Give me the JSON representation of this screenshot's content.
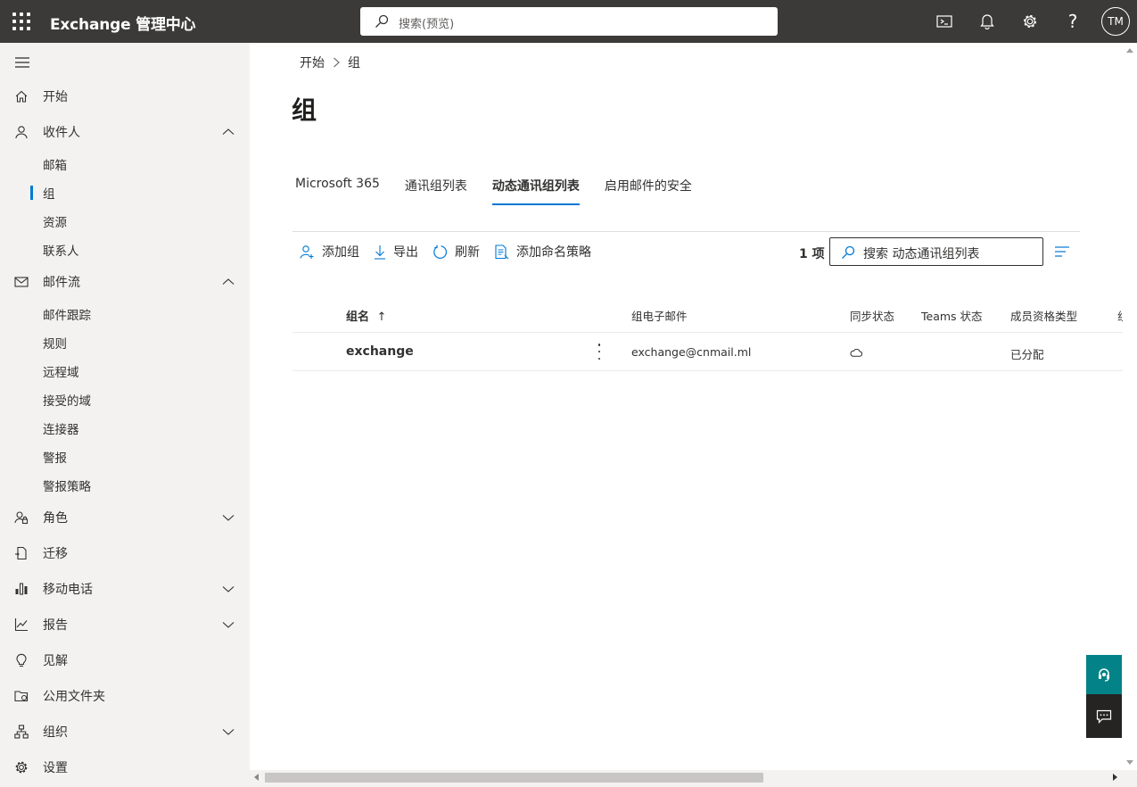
{
  "header": {
    "app_title": "Exchange 管理中心",
    "search_placeholder": "搜索(预览)",
    "avatar_initials": "TM"
  },
  "sidebar": {
    "items": [
      {
        "label": "开始",
        "icon": "home-icon"
      },
      {
        "label": "收件人",
        "icon": "person-icon",
        "expanded": true,
        "children": [
          "邮箱",
          "组",
          "资源",
          "联系人"
        ]
      },
      {
        "label": "邮件流",
        "icon": "mail-icon",
        "expanded": true,
        "children": [
          "邮件跟踪",
          "规则",
          "远程域",
          "接受的域",
          "连接器",
          "警报",
          "警报策略"
        ]
      },
      {
        "label": "角色",
        "icon": "roles-icon",
        "expanded": false
      },
      {
        "label": "迁移",
        "icon": "migration-icon"
      },
      {
        "label": "移动电话",
        "icon": "mobile-icon",
        "expanded": false
      },
      {
        "label": "报告",
        "icon": "reports-icon",
        "expanded": false
      },
      {
        "label": "见解",
        "icon": "lightbulb-icon"
      },
      {
        "label": "公用文件夹",
        "icon": "public-folder-icon"
      },
      {
        "label": "组织",
        "icon": "org-icon",
        "expanded": false
      },
      {
        "label": "设置",
        "icon": "settings-icon"
      }
    ],
    "active_child": "组"
  },
  "main": {
    "breadcrumb": [
      "开始",
      "组"
    ],
    "title": "组",
    "tabs": [
      {
        "label": "Microsoft 365",
        "active": false
      },
      {
        "label": "通讯组列表",
        "active": false
      },
      {
        "label": "动态通讯组列表",
        "active": true
      },
      {
        "label": "启用邮件的安全",
        "active": false
      }
    ],
    "toolbar": {
      "add_group": "添加组",
      "export": "导出",
      "refresh": "刷新",
      "add_naming_policy": "添加命名策略",
      "count": "1 项",
      "search_value": "搜索 动态通讯组列表"
    },
    "table": {
      "columns": [
        "组名",
        "组电子邮件",
        "同步状态",
        "Teams 状态",
        "成员资格类型",
        "组"
      ],
      "sort_indicator": "↑",
      "rows": [
        {
          "name": "exchange",
          "email": "exchange@cnmail.ml",
          "sync_icon": "cloud-icon",
          "teams": "",
          "membership": "已分配"
        }
      ]
    }
  },
  "colors": {
    "topbar": "#3b3a39",
    "accent": "#0078d4",
    "help_fab": "#038387",
    "feedback_fab": "#252423"
  }
}
